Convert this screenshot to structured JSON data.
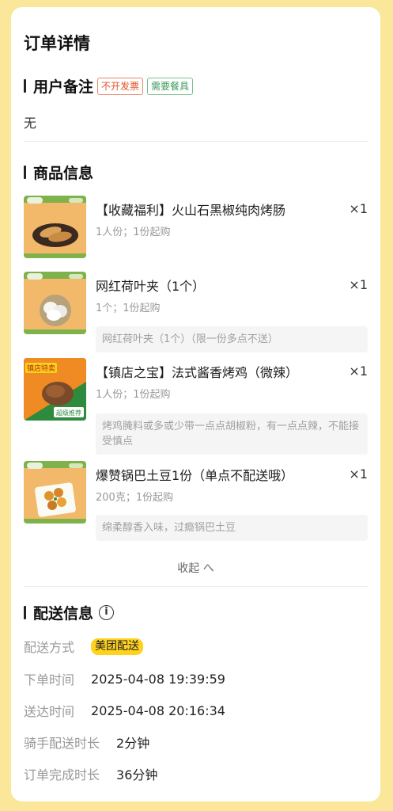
{
  "page_title": "订单详情",
  "remark": {
    "title": "用户备注",
    "tags": [
      "不开发票",
      "需要餐具"
    ],
    "text": "无"
  },
  "goods": {
    "title": "商品信息",
    "items": [
      {
        "name": "【收藏福利】火山石黑椒纯肉烤肠",
        "qty": "×1",
        "sub": "1人份；1份起购",
        "note": ""
      },
      {
        "name": "网红荷叶夹（1个）",
        "qty": "×1",
        "sub": "1个；1份起购",
        "note": "网红荷叶夹（1个）（限一份多点不送）"
      },
      {
        "name": "【镇店之宝】法式酱香烤鸡（微辣）",
        "qty": "×1",
        "sub": "1人份；1份起购",
        "note": "烤鸡腌料或多或少带一点点胡椒粉，有一点点辣，不能接受慎点"
      },
      {
        "name": "爆赞锅巴土豆1份（单点不配送哦）",
        "qty": "×1",
        "sub": "200克；1份起购",
        "note": "绵柔醇香入味，过瘾锅巴土豆"
      }
    ],
    "collapse_label": "收起 へ",
    "thumb3_badge_top": "镇店特卖",
    "thumb3_badge_bottom": "超级推荐"
  },
  "delivery": {
    "title": "配送信息",
    "info_icon": "i",
    "rows": [
      {
        "label": "配送方式",
        "value": "美团配送"
      },
      {
        "label": "下单时间",
        "value": "2025-04-08 19:39:59"
      },
      {
        "label": "送达时间",
        "value": "2025-04-08 20:16:34"
      },
      {
        "label": "骑手配送时长",
        "value": "2分钟"
      },
      {
        "label": "订单完成时长",
        "value": "36分钟"
      }
    ]
  },
  "colors": {
    "background": "#fbe79a",
    "badge": "#ffd21e",
    "tag_red": "#e0532b",
    "tag_green": "#3a9a5a"
  }
}
